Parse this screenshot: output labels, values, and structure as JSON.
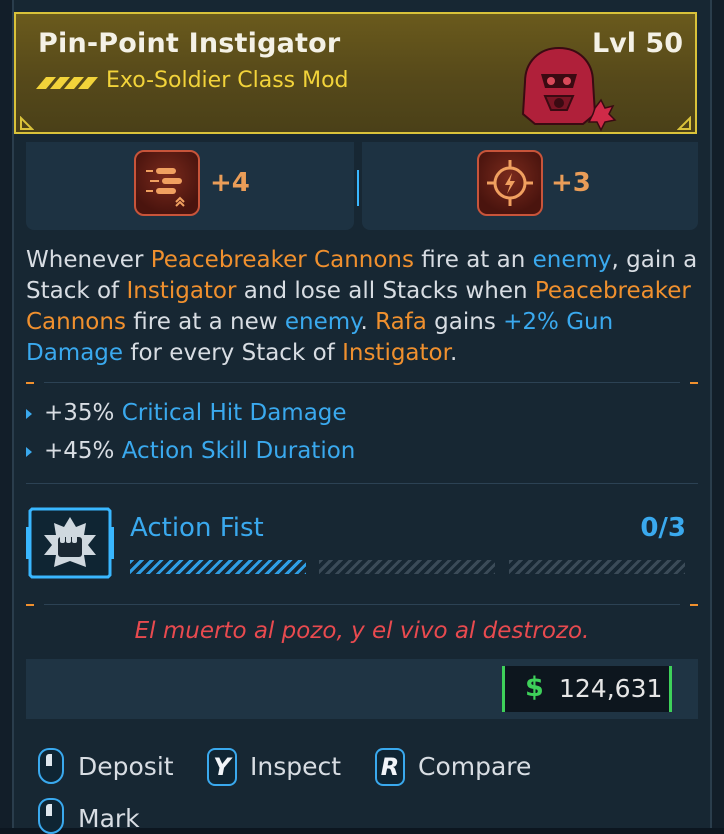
{
  "item": {
    "name": "Pin-Point Instigator",
    "subtitle": "Exo-Soldier Class Mod",
    "level": "Lvl 50"
  },
  "stats": [
    {
      "icon": "bullets-skill-icon",
      "value": "+4"
    },
    {
      "icon": "crosshair-skill-icon",
      "value": "+3"
    }
  ],
  "description": {
    "s1": "Whenever ",
    "s2": "Peacebreaker Cannons",
    "s3": " fire at an ",
    "s4": "enemy",
    "s5": ", gain a Stack of ",
    "s6": "Instigator",
    "s7": " and lose all Stacks when ",
    "s8": "Peacebreaker Cannons",
    "s9": " fire at a new ",
    "s10": "enemy",
    "s11": ". ",
    "s12": "Rafa",
    "s13": " gains ",
    "s14": "+2% Gun Damage",
    "s15": " for every Stack of ",
    "s16": "Instigator",
    "s17": "."
  },
  "bonuses": [
    {
      "value": "+35%",
      "label": "Critical Hit Damage"
    },
    {
      "value": "+45%",
      "label": "Action Skill Duration"
    }
  ],
  "action_fist": {
    "label": "Action Fist",
    "progress_text": "0/3",
    "segments_filled": 1,
    "segments_total": 3
  },
  "flavor_text": "El muerto al pozo, y el vivo al destrozo.",
  "price": {
    "symbol": "$",
    "value": "124,631"
  },
  "controls": [
    {
      "key": "",
      "label": "Deposit"
    },
    {
      "key": "Y",
      "label": "Inspect"
    },
    {
      "key": "R",
      "label": "Compare"
    },
    {
      "key": "",
      "label": "Mark"
    }
  ],
  "colors": {
    "header_border": "#d9c23a",
    "highlight_orange": "#f0902e",
    "highlight_blue": "#3aa9ee",
    "flavor_red": "#e84a4f",
    "price_green": "#3ed15a"
  }
}
